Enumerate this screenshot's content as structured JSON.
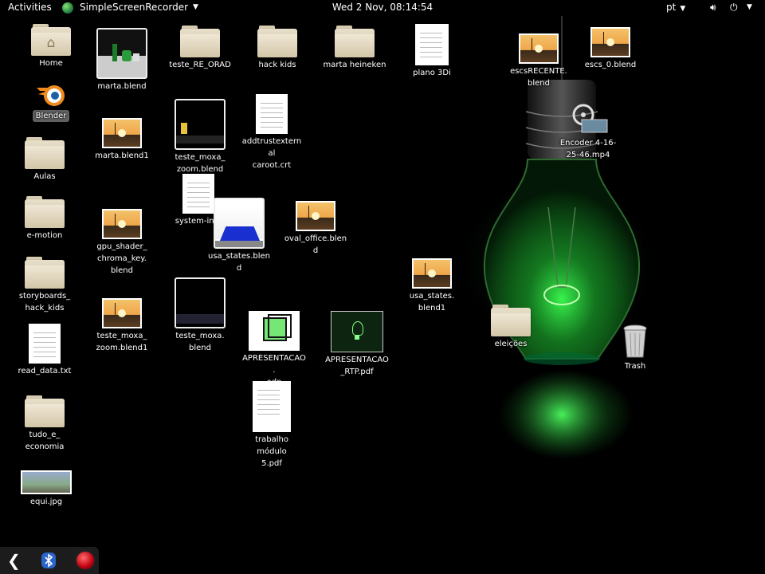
{
  "topbar": {
    "activities": "Activities",
    "app_name": "SimpleScreenRecorder",
    "clock": "Wed  2 Nov, 08:14:54",
    "language": "pt"
  },
  "desktop": {
    "icons": {
      "home": "Home",
      "blender": "Blender",
      "aulas": "Aulas",
      "emotion": "e-motion",
      "storyboards": "storyboards_\nhack_kids",
      "read_data": "read_data.txt",
      "tudo": "tudo_e_\neconomia",
      "equi": "equi.jpg",
      "marta_blend": "marta.blend",
      "marta_blend1": "marta.blend1",
      "gpu_shader": "gpu_shader_\nchroma_key.\nblend",
      "teste_moxa_zoom_blend1": "teste_moxa_\nzoom.blend1",
      "teste_re_orad": "teste_RE_ORAD",
      "teste_moxa_zoom_blend": "teste_moxa_\nzoom.blend",
      "system_info": "system-info",
      "usa_states_blend": "usa_states.blend",
      "teste_moxa_blend": "teste_moxa.\nblend",
      "hack_kids": "hack kids",
      "addtrust": "addtrustexternal\ncaroot.crt",
      "oval_office": "oval_office.blend",
      "apresentacao_odp": "APRESENTACAO.\nodp",
      "trabalho": "trabalho módulo\n5.pdf",
      "marta_heineken": "marta heineken",
      "apresentacao_rtp": "APRESENTACAO\n_RTP.pdf",
      "plano_3di": "plano 3Di",
      "usa_states_blend1": "usa_states.\nblend1",
      "escs_recente": "escsRECENTE.\nblend",
      "escs_0": "escs_0.blend",
      "encoder": "Encoder 4-16-\n25-46.mp4",
      "eleicoes": "eleições",
      "trash": "Trash"
    }
  },
  "colors": {
    "topbar_bg": "#000000",
    "folder": "#e0d6bf",
    "bulb_glow": "#33dd44",
    "record_button": "#d00010"
  },
  "icons": {
    "dock_back": "chevron-left-icon",
    "dock_bluetooth": "bluetooth-icon",
    "dock_record": "record-icon",
    "tray_sound": "volume-icon",
    "tray_power": "power-icon"
  }
}
